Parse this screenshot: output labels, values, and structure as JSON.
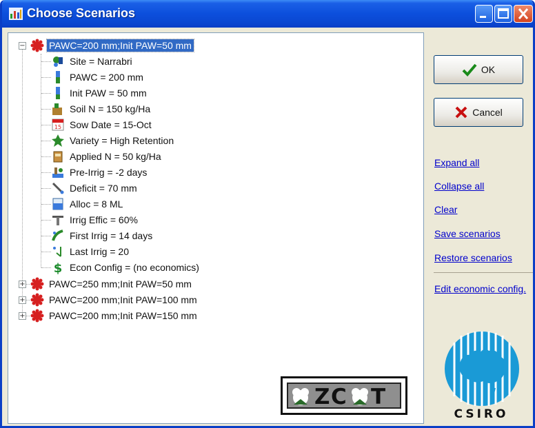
{
  "window": {
    "title": "Choose Scenarios",
    "controls": [
      "minimize-icon",
      "maximize-icon",
      "close-icon"
    ]
  },
  "tree": {
    "roots": [
      {
        "label": "PAWC=200 mm;Init PAW=50 mm",
        "expanded": true,
        "selected": true,
        "children": [
          {
            "label": "Site = Narrabri",
            "icon": "site-icon"
          },
          {
            "label": "PAWC = 200 mm",
            "icon": "pawc-icon"
          },
          {
            "label": "Init PAW = 50 mm",
            "icon": "init-paw-icon"
          },
          {
            "label": "Soil N = 150 kg/Ha",
            "icon": "soil-n-icon"
          },
          {
            "label": "Sow Date = 15-Oct",
            "icon": "calendar-icon"
          },
          {
            "label": "Variety = High Retention",
            "icon": "variety-icon"
          },
          {
            "label": "Applied N = 50 kg/Ha",
            "icon": "fertilizer-icon"
          },
          {
            "label": "Pre-Irrig = -2 days",
            "icon": "pre-irrig-icon"
          },
          {
            "label": "Deficit = 70 mm",
            "icon": "deficit-icon"
          },
          {
            "label": "Alloc = 8 ML",
            "icon": "alloc-icon"
          },
          {
            "label": "Irrig Effic = 60%",
            "icon": "irrig-effic-icon"
          },
          {
            "label": "First Irrig = 14 days",
            "icon": "first-irrig-icon"
          },
          {
            "label": "Last Irrig = 20",
            "icon": "last-irrig-icon"
          },
          {
            "label": "Econ Config = (no economics)",
            "icon": "dollar-icon"
          }
        ]
      },
      {
        "label": "PAWC=250 mm;Init PAW=50 mm",
        "expanded": false
      },
      {
        "label": "PAWC=200 mm;Init PAW=100 mm",
        "expanded": false
      },
      {
        "label": "PAWC=200 mm;Init PAW=150 mm",
        "expanded": false
      }
    ]
  },
  "buttons": {
    "ok": "OK",
    "cancel": "Cancel"
  },
  "links": {
    "expand_all": "Expand all",
    "collapse_all": "Collapse all",
    "clear": "Clear",
    "save_scenarios": "Save scenarios",
    "restore_scenarios": "Restore scenarios",
    "edit_econ": "Edit economic config."
  },
  "logos": {
    "zcot": "ZCOT",
    "csiro": "CSIRO"
  },
  "colors": {
    "titlebar": "#0a46d0",
    "selection": "#316ac5",
    "link": "#0000cc",
    "panel": "#ece9d8"
  }
}
